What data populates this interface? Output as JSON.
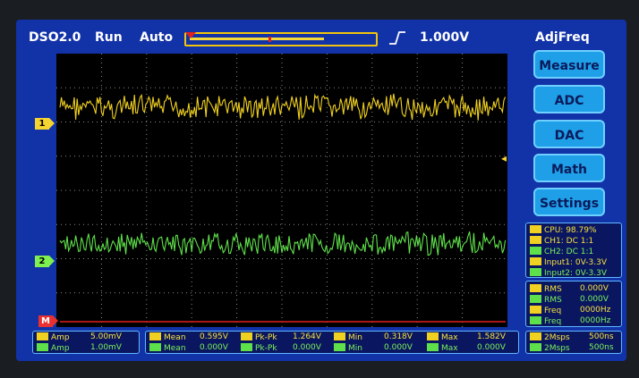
{
  "topbar": {
    "model": "DSO2.0",
    "run_state": "Run",
    "trigger_mode": "Auto",
    "trigger_level": "1.000V",
    "menu_title": "AdjFreq"
  },
  "side_menu": {
    "items": [
      "Measure",
      "ADC",
      "DAC",
      "Math",
      "Settings"
    ]
  },
  "channel_markers": {
    "ch1": "1",
    "ch2": "2",
    "math": "M"
  },
  "status_panel": {
    "cpu": "CPU: 98.79%",
    "ch1": "CH1: DC 1:1",
    "ch2": "CH2: DC 1:1",
    "input1": "Input1: 0V-3.3V",
    "input2": "Input2: 0V-3.3V"
  },
  "measure_panel": {
    "rms1": "RMS",
    "rms1_val": "0.000V",
    "rms2": "RMS",
    "rms2_val": "0.000V",
    "freq1": "Freq",
    "freq1_val": "0000Hz",
    "freq2": "Freq",
    "freq2_val": "0000Hz"
  },
  "timebase_panel": {
    "ch1_rate": "2Msps",
    "ch1_div": "500ns",
    "ch2_rate": "2Msps",
    "ch2_div": "500ns"
  },
  "bottom": {
    "amp": {
      "label": "Amp",
      "ch1": "5.00mV",
      "ch2": "1.00mV"
    },
    "mean": {
      "label": "Mean",
      "ch1": "0.595V",
      "ch2": "0.000V"
    },
    "pkpk": {
      "label": "Pk-Pk",
      "ch1": "1.264V",
      "ch2": "0.000V"
    },
    "min": {
      "label": "Min",
      "ch1": "0.318V",
      "ch2": "0.000V"
    },
    "max": {
      "label": "Max",
      "ch1": "1.582V",
      "ch2": "0.000V"
    }
  },
  "colors": {
    "screen": "#1232a8",
    "ch1": "#f0d020",
    "ch2": "#5ee04a",
    "math": "#e02020",
    "button": "#1f9fe8"
  }
}
